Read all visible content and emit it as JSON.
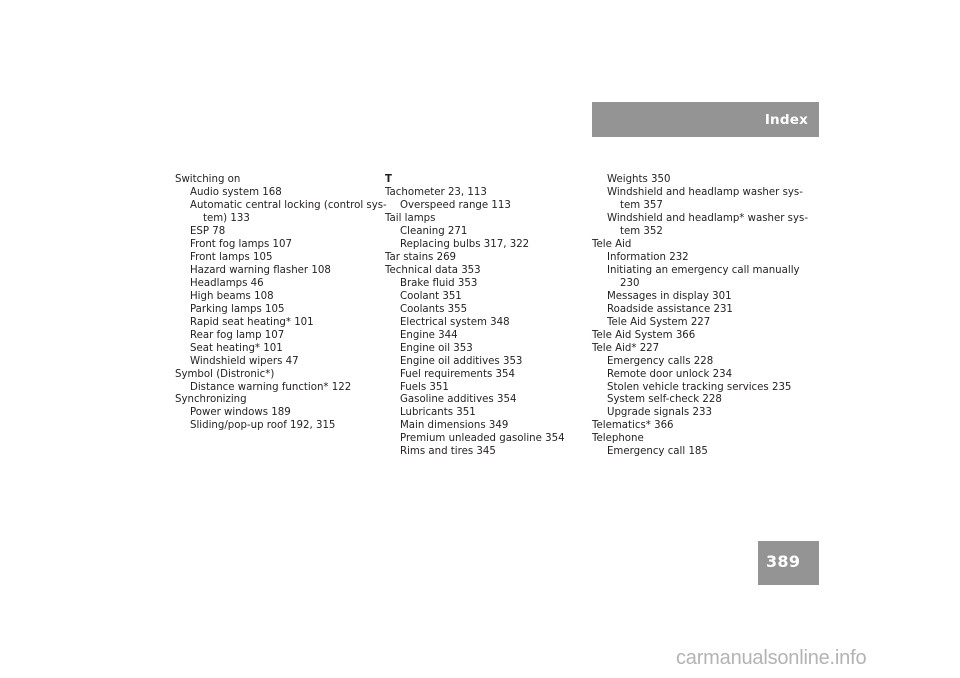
{
  "header": {
    "title": "Index",
    "band_color": "#949494"
  },
  "page_number": {
    "value": "389",
    "band_color": "#949494"
  },
  "watermark": {
    "text": "carmanualsonline.info",
    "color": "#b3b3b3"
  },
  "columns": [
    {
      "id": "column-1",
      "entries": [
        {
          "level": 0,
          "text": "Switching on"
        },
        {
          "level": 1,
          "text": "Audio system 168"
        },
        {
          "level": 1,
          "text": "Automatic central locking (control sys-"
        },
        {
          "level": 2,
          "text": "tem) 133"
        },
        {
          "level": 1,
          "text": "ESP 78"
        },
        {
          "level": 1,
          "text": "Front fog lamps 107"
        },
        {
          "level": 1,
          "text": "Front lamps 105"
        },
        {
          "level": 1,
          "text": "Hazard warning flasher 108"
        },
        {
          "level": 1,
          "text": "Headlamps 46"
        },
        {
          "level": 1,
          "text": "High beams 108"
        },
        {
          "level": 1,
          "text": "Parking lamps 105"
        },
        {
          "level": 1,
          "text": "Rapid seat heating* 101"
        },
        {
          "level": 1,
          "text": "Rear fog lamp 107"
        },
        {
          "level": 1,
          "text": "Seat heating* 101"
        },
        {
          "level": 1,
          "text": "Windshield wipers 47"
        },
        {
          "level": 0,
          "text": "Symbol (Distronic*)"
        },
        {
          "level": 1,
          "text": "Distance warning function* 122"
        },
        {
          "level": 0,
          "text": "Synchronizing"
        },
        {
          "level": 1,
          "text": "Power windows 189"
        },
        {
          "level": 1,
          "text": "Sliding/pop-up roof 192, 315"
        }
      ]
    },
    {
      "id": "column-2",
      "entries": [
        {
          "level": "letter",
          "text": "T"
        },
        {
          "level": 0,
          "text": "Tachometer 23, 113"
        },
        {
          "level": 1,
          "text": "Overspeed range 113"
        },
        {
          "level": 0,
          "text": "Tail lamps"
        },
        {
          "level": 1,
          "text": "Cleaning 271"
        },
        {
          "level": 1,
          "text": "Replacing bulbs 317, 322"
        },
        {
          "level": 0,
          "text": "Tar stains 269"
        },
        {
          "level": 0,
          "text": "Technical data 353"
        },
        {
          "level": 1,
          "text": "Brake fluid 353"
        },
        {
          "level": 1,
          "text": "Coolant 351"
        },
        {
          "level": 1,
          "text": "Coolants 355"
        },
        {
          "level": 1,
          "text": "Electrical system 348"
        },
        {
          "level": 1,
          "text": "Engine 344"
        },
        {
          "level": 1,
          "text": "Engine oil 353"
        },
        {
          "level": 1,
          "text": "Engine oil additives 353"
        },
        {
          "level": 1,
          "text": "Fuel requirements 354"
        },
        {
          "level": 1,
          "text": "Fuels 351"
        },
        {
          "level": 1,
          "text": "Gasoline additives 354"
        },
        {
          "level": 1,
          "text": "Lubricants 351"
        },
        {
          "level": 1,
          "text": "Main dimensions 349"
        },
        {
          "level": 1,
          "text": "Premium unleaded gasoline 354"
        },
        {
          "level": 1,
          "text": "Rims and tires 345"
        }
      ]
    },
    {
      "id": "column-3",
      "entries": [
        {
          "level": 1,
          "text": "Weights 350"
        },
        {
          "level": 1,
          "text": "Windshield and headlamp washer sys-"
        },
        {
          "level": 2,
          "text": "tem 357"
        },
        {
          "level": 1,
          "text": "Windshield and headlamp* washer sys-"
        },
        {
          "level": 2,
          "text": "tem 352"
        },
        {
          "level": 0,
          "text": "Tele Aid"
        },
        {
          "level": 1,
          "text": "Information 232"
        },
        {
          "level": 1,
          "text": "Initiating an emergency call manually"
        },
        {
          "level": 2,
          "text": "230"
        },
        {
          "level": 1,
          "text": "Messages in display 301"
        },
        {
          "level": 1,
          "text": "Roadside assistance 231"
        },
        {
          "level": 1,
          "text": "Tele Aid System 227"
        },
        {
          "level": 0,
          "text": "Tele Aid System 366"
        },
        {
          "level": 0,
          "text": "Tele Aid* 227"
        },
        {
          "level": 1,
          "text": "Emergency calls 228"
        },
        {
          "level": 1,
          "text": "Remote door unlock 234"
        },
        {
          "level": 1,
          "text": "Stolen vehicle tracking services 235"
        },
        {
          "level": 1,
          "text": "System self-check 228"
        },
        {
          "level": 1,
          "text": "Upgrade signals 233"
        },
        {
          "level": 0,
          "text": "Telematics* 366"
        },
        {
          "level": 0,
          "text": "Telephone"
        },
        {
          "level": 1,
          "text": "Emergency call 185"
        }
      ]
    }
  ]
}
